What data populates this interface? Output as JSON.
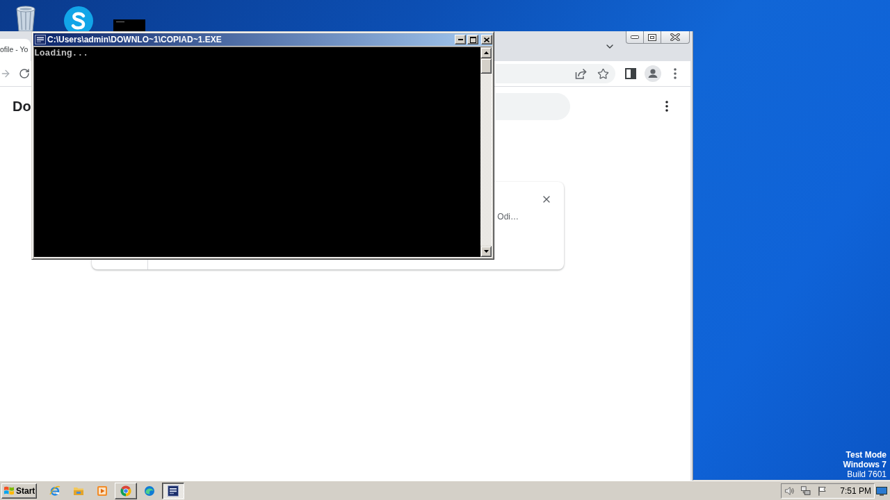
{
  "desktop": {
    "notice": [
      "Test Mode",
      "Windows 7",
      "Build 7601"
    ]
  },
  "browser": {
    "tab": {
      "title": "ofile - Yo",
      "selected": true
    },
    "heading": "Do",
    "card": {
      "text": "Odi…"
    }
  },
  "console": {
    "title": "C:\\Users\\admin\\DOWNLO~1\\COPIAD~1.EXE",
    "active": true,
    "output": [
      "Loading..."
    ]
  },
  "taskbar": {
    "start": "Start",
    "items": [
      {
        "kind": "launcher",
        "selected": false
      },
      {
        "kind": "launcher",
        "selected": false
      },
      {
        "kind": "launcher",
        "selected": false
      },
      {
        "kind": "task",
        "selected": false
      },
      {
        "kind": "launcher",
        "selected": false
      },
      {
        "kind": "task",
        "selected": true
      }
    ],
    "clock": "7:51 PM"
  }
}
